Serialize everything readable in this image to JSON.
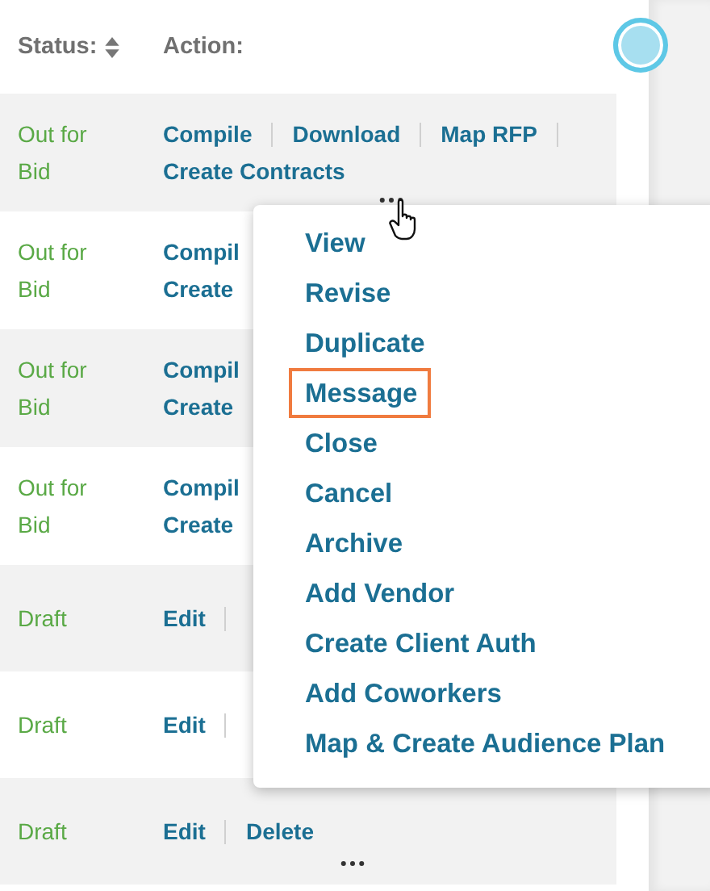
{
  "table": {
    "columns": [
      {
        "label": "Status:",
        "sortable": true
      },
      {
        "label": "Action:",
        "sortable": false
      }
    ],
    "rows": [
      {
        "status": "Out for Bid",
        "lines": [
          {
            "actions": [
              "Compile",
              "Download",
              "Map RFP"
            ],
            "trail": true
          },
          {
            "actions": [
              "Create Contracts"
            ],
            "trail": false
          }
        ],
        "more": true,
        "cursor": true
      },
      {
        "status": "Out for Bid",
        "lines": [
          {
            "actions": [
              "Compil"
            ],
            "trail": false
          },
          {
            "actions": [
              "Create"
            ],
            "trail": false
          }
        ],
        "more": false,
        "cursor": false
      },
      {
        "status": "Out for Bid",
        "lines": [
          {
            "actions": [
              "Compil"
            ],
            "trail": false
          },
          {
            "actions": [
              "Create"
            ],
            "trail": false
          }
        ],
        "more": false,
        "cursor": false
      },
      {
        "status": "Out for Bid",
        "lines": [
          {
            "actions": [
              "Compil"
            ],
            "trail": false
          },
          {
            "actions": [
              "Create"
            ],
            "trail": false
          }
        ],
        "more": false,
        "cursor": false
      },
      {
        "status": "Draft",
        "lines": [
          {
            "actions": [
              "Edit"
            ],
            "trail": true
          }
        ],
        "more": false,
        "cursor": false
      },
      {
        "status": "Draft",
        "lines": [
          {
            "actions": [
              "Edit"
            ],
            "trail": true
          }
        ],
        "more": false,
        "cursor": false
      },
      {
        "status": "Draft",
        "lines": [
          {
            "actions": [
              "Edit",
              "Delete"
            ],
            "trail": false
          }
        ],
        "more": true,
        "cursor": false
      }
    ]
  },
  "menu": {
    "items": [
      {
        "label": "View",
        "selected": false
      },
      {
        "label": "Revise",
        "selected": false
      },
      {
        "label": "Duplicate",
        "selected": false
      },
      {
        "label": "Message",
        "selected": true
      },
      {
        "label": "Close",
        "selected": false
      },
      {
        "label": "Cancel",
        "selected": false
      },
      {
        "label": "Archive",
        "selected": false
      },
      {
        "label": "Add Vendor",
        "selected": false
      },
      {
        "label": "Create Client Auth",
        "selected": false
      },
      {
        "label": "Add Coworkers",
        "selected": false
      },
      {
        "label": "Map & Create Audience Plan",
        "selected": false
      }
    ]
  }
}
